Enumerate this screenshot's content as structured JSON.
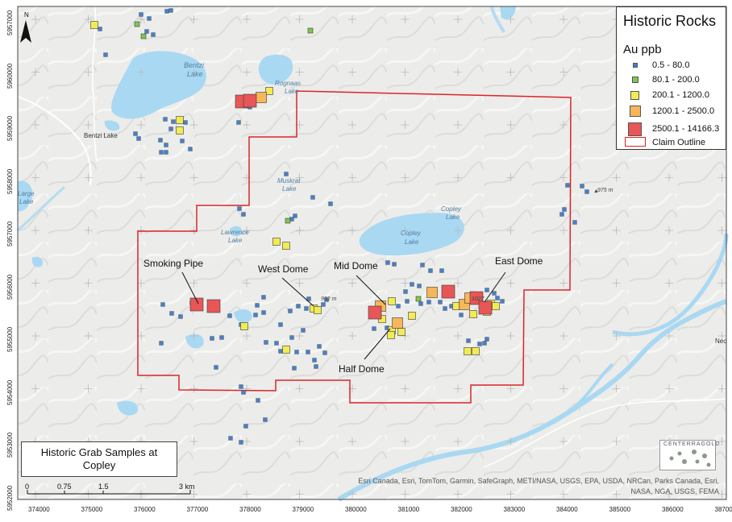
{
  "legend": {
    "title": "Historic Rocks",
    "subtitle": "Au ppb",
    "classes": [
      {
        "label": "0.5 - 80.0",
        "color": "#4a7fc4"
      },
      {
        "label": "80.1 - 200.0",
        "color": "#7ec850"
      },
      {
        "label": "200.1 - 1200.0",
        "color": "#f2ec54"
      },
      {
        "label": "1200.1 - 2500.0",
        "color": "#f7b659"
      },
      {
        "label": "2500.1 - 14166.3",
        "color": "#e85657"
      }
    ],
    "claim_label": "Claim Outline",
    "claim_color": "#d8262b"
  },
  "map_title": {
    "line1": "Historic Grab Samples at",
    "line2": "Copley"
  },
  "attribution": {
    "line1": "Esri Canada, Esri, TomTom, Garmin, SafeGraph, METI/NASA, USGS, EPA, USDA, NRCan, Parks Canada, Esri,",
    "line2": "NASA, NGA, USGS, FEMA"
  },
  "logo_text": "CENTERRAGOLD",
  "north_label": "N",
  "scale_bar": {
    "labels": [
      "0",
      "0.75",
      "1.5",
      "3 km"
    ]
  },
  "place_labels": {
    "bentzi_lake_1": "Bentzi",
    "bentzi_lake_2": "Lake",
    "bentzi_lake_town": "Bentzi Lake",
    "rognaas_1": "Rognaas",
    "rognaas_2": "Lake",
    "muskrat_1": "Muskrat",
    "muskrat_2": "Lake",
    "lawrence_1": "Lawrence",
    "lawrence_2": "Lake",
    "copley_1a": "Copley",
    "copley_1b": "Lake",
    "copley_2a": "Copley",
    "copley_2b": "Lake",
    "large_1": "Large",
    "large_2": "Lake",
    "elev_975": "975 m",
    "elev_952": "952 m",
    "elev_1027": "1027",
    "nec": "Nec"
  },
  "target_labels": {
    "smoking_pipe": "Smoking Pipe",
    "west_dome": "West Dome",
    "mid_dome": "Mid Dome",
    "east_dome": "East Dome",
    "half_dome": "Half Dome"
  },
  "grid_labels": {
    "easting": [
      "374000",
      "375000",
      "376000",
      "377000",
      "378000",
      "379000",
      "380000",
      "381000",
      "382000",
      "383000",
      "384000",
      "385000",
      "386000",
      "387000"
    ],
    "northing": [
      "5957000",
      "5960000",
      "5959000",
      "5958000",
      "5957000",
      "5956000",
      "5955000",
      "5954000",
      "5953000",
      "5952000"
    ]
  }
}
